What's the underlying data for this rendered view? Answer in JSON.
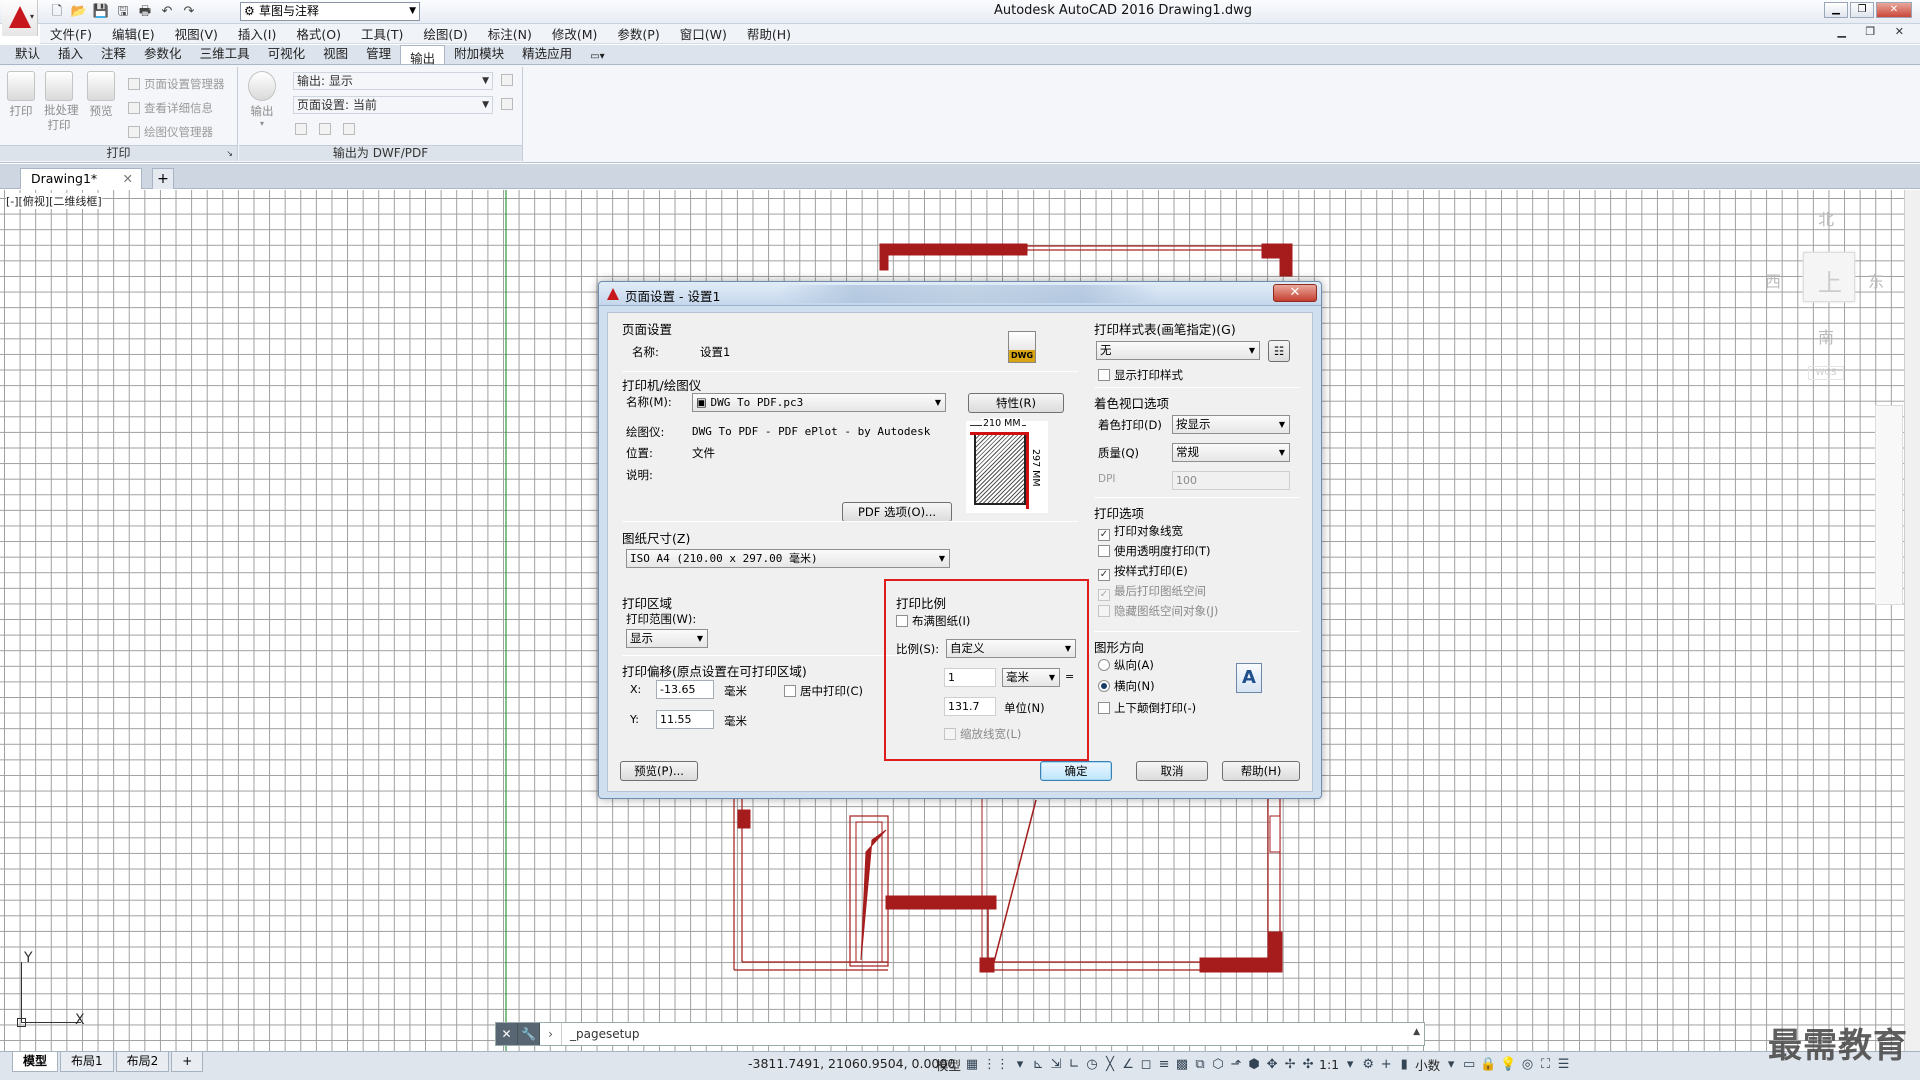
{
  "app": {
    "title": "Autodesk AutoCAD 2016    Drawing1.dwg",
    "workspace": "草图与注释",
    "accent": "#c8161d"
  },
  "menu": [
    "文件(F)",
    "编辑(E)",
    "视图(V)",
    "插入(I)",
    "格式(O)",
    "工具(T)",
    "绘图(D)",
    "标注(N)",
    "修改(M)",
    "参数(P)",
    "窗口(W)",
    "帮助(H)"
  ],
  "ribbon_tabs": [
    {
      "label": "默认",
      "active": false
    },
    {
      "label": "插入",
      "active": false
    },
    {
      "label": "注释",
      "active": false
    },
    {
      "label": "参数化",
      "active": false
    },
    {
      "label": "三维工具",
      "active": false
    },
    {
      "label": "可视化",
      "active": false
    },
    {
      "label": "视图",
      "active": false
    },
    {
      "label": "管理",
      "active": false
    },
    {
      "label": "输出",
      "active": true
    },
    {
      "label": "附加模块",
      "active": false
    },
    {
      "label": "精选应用",
      "active": false
    }
  ],
  "ribbon": {
    "print_panel": {
      "title": "打印",
      "plot": "打印",
      "batch_plot": "批处理\n打印",
      "preview": "预览",
      "page_setup_manager": "页面设置管理器",
      "view_details": "查看详细信息",
      "plotter_manager": "绘图仪管理器"
    },
    "export_panel": {
      "title": "输出为 DWF/PDF",
      "export": "输出",
      "export_combo": "输出: 显示",
      "page_setup_combo": "页面设置: 当前"
    }
  },
  "doc_tabs": {
    "active": "Drawing1*"
  },
  "viewport": {
    "label": "[-][俯视][二维线框]",
    "compass": {
      "north": "北",
      "south": "南",
      "east": "东",
      "west": "西",
      "top": "上",
      "wcs": "WCS"
    }
  },
  "ucs": {
    "x": "X",
    "y": "Y"
  },
  "command_line": {
    "text": "_pagesetup"
  },
  "status": {
    "layout_tabs": [
      "模型",
      "布局1",
      "布局2"
    ],
    "coords": "-3811.7491, 21060.9504, 0.0000",
    "model": "模型",
    "scale": "1:1",
    "units": "小数"
  },
  "watermark": "最需教育",
  "dialog": {
    "title": "页面设置 - 设置1",
    "page_setup": {
      "group": "页面设置",
      "name_label": "名称:",
      "name_value": "设置1",
      "dwg_badge": "DWG"
    },
    "printer": {
      "group": "打印机/绘图仪",
      "name_label": "名称(M):",
      "name_value": "DWG To PDF.pc3",
      "properties_btn": "特性(R)",
      "plotter_label": "绘图仪:",
      "plotter_value": "DWG To PDF - PDF ePlot - by Autodesk",
      "location_label": "位置:",
      "location_value": "文件",
      "desc_label": "说明:",
      "pdf_options_btn": "PDF 选项(O)...",
      "paper_w": "210 MM",
      "paper_h": "297 MM"
    },
    "paper_size": {
      "group": "图纸尺寸(Z)",
      "value": "ISO A4 (210.00 x 297.00 毫米)"
    },
    "plot_area": {
      "group": "打印区域",
      "range_label": "打印范围(W):",
      "range_value": "显示"
    },
    "plot_offset": {
      "group": "打印偏移(原点设置在可打印区域)",
      "x_label": "X:",
      "x_value": "-13.65",
      "x_unit": "毫米",
      "y_label": "Y:",
      "y_value": "11.55",
      "y_unit": "毫米",
      "center_label": "居中打印(C)",
      "center_checked": false
    },
    "plot_scale": {
      "group": "打印比例",
      "fit_label": "布满图纸(I)",
      "fit_checked": false,
      "scale_label": "比例(S):",
      "scale_value": "自定义",
      "value1": "1",
      "unit": "毫米",
      "equals": "=",
      "value2": "131.7",
      "unit2": "单位(N)",
      "scale_lw_label": "缩放线宽(L)",
      "scale_lw_checked": false
    },
    "plot_style": {
      "group": "打印样式表(画笔指定)(G)",
      "value": "无",
      "show_label": "显示打印样式",
      "show_checked": false
    },
    "shaded": {
      "group": "着色视口选项",
      "shade_label": "着色打印(D)",
      "shade_value": "按显示",
      "quality_label": "质量(Q)",
      "quality_value": "常规",
      "dpi_label": "DPI",
      "dpi_value": "100"
    },
    "plot_options": {
      "group": "打印选项",
      "items": [
        {
          "label": "打印对象线宽",
          "checked": true,
          "disabled": false
        },
        {
          "label": "使用透明度打印(T)",
          "checked": false,
          "disabled": false
        },
        {
          "label": "按样式打印(E)",
          "checked": true,
          "disabled": false
        },
        {
          "label": "最后打印图纸空间",
          "checked": true,
          "disabled": true
        },
        {
          "label": "隐藏图纸空间对象(J)",
          "checked": false,
          "disabled": true
        }
      ]
    },
    "orientation": {
      "group": "图形方向",
      "portrait": "纵向(A)",
      "landscape": "横向(N)",
      "upside": "上下颠倒打印(-)",
      "selected": "landscape",
      "upside_checked": false,
      "icon_letter": "A"
    },
    "buttons": {
      "preview": "预览(P)...",
      "ok": "确定",
      "cancel": "取消",
      "help": "帮助(H)"
    }
  }
}
